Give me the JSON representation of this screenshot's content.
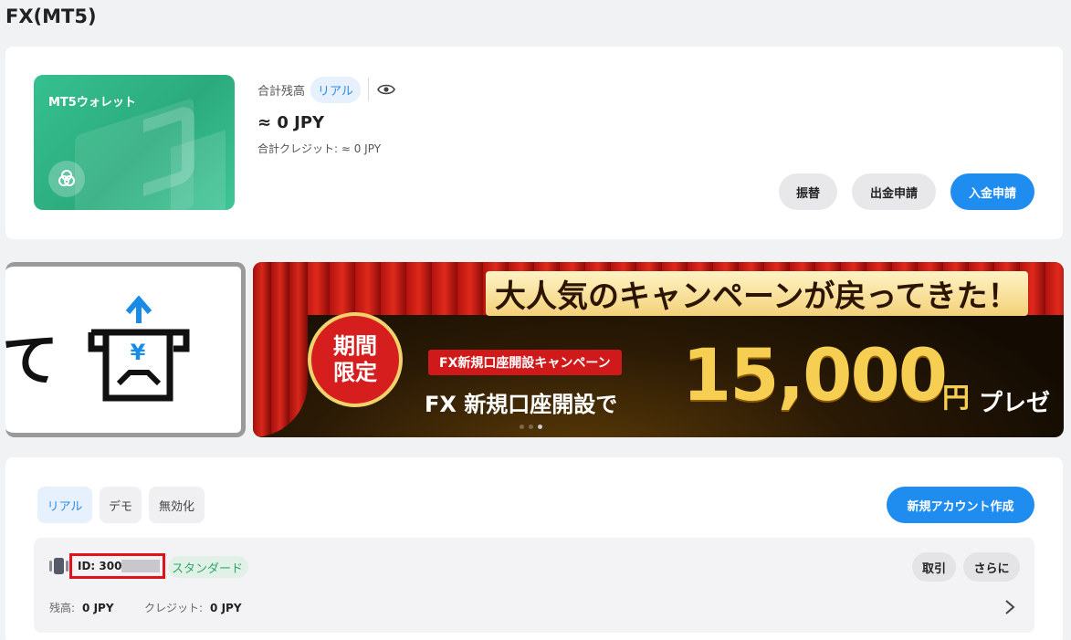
{
  "page_title": "FX(MT5)",
  "wallet": {
    "card_name": "MT5ウォレット",
    "balance_label": "合計残高",
    "mode_chip": "リアル",
    "balance_value": "≈ 0 JPY",
    "credit_text": "合計クレジット: ≈ 0 JPY",
    "buttons": {
      "transfer": "振替",
      "withdraw": "出金申請",
      "deposit": "入金申請"
    }
  },
  "banner_left": {
    "text": "て"
  },
  "banner": {
    "headline": "大人気のキャンペーンが戻ってきた！",
    "badge": "期間限定",
    "campaign_name": "FX新規口座開設キャンペーン",
    "sub": "FX 新規口座開設で",
    "amount": "15,000",
    "yen": "円",
    "present": "プレゼ"
  },
  "accounts": {
    "tabs": [
      "リアル",
      "デモ",
      "無効化"
    ],
    "create_button": "新規アカウント作成",
    "rows": [
      {
        "id_label": "ID: 300",
        "type_chip": "スタンダード",
        "trade_button": "取引",
        "more_button": "さらに",
        "balance_label": "残高:",
        "balance_value": "0 JPY",
        "credit_label": "クレジット:",
        "credit_value": "0 JPY"
      }
    ]
  },
  "colors": {
    "accent": "#1f8cf0",
    "wallet_green": "#2bab7d",
    "highlight_red": "#e0121a"
  }
}
